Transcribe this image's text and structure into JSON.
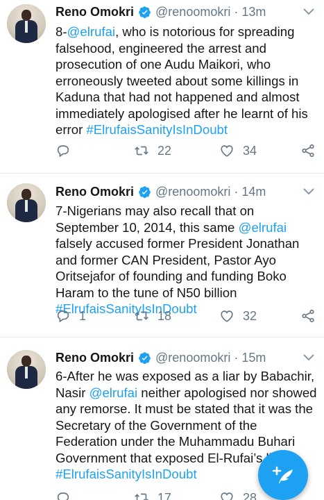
{
  "tweets": [
    {
      "name": "Reno Omokri",
      "handle": "@renoomokri",
      "dot": "·",
      "time": "13m",
      "text": [
        {
          "t": "8-",
          "link": false
        },
        {
          "t": "@elrufai",
          "link": true
        },
        {
          "t": ", who is notorious for spreading falsehood, engineered the arrest and prosecution of one Audu Maikori, who erroneously tweeted about some killings in Kaduna that had not happened and almost immediately apologised after he learnt of his error ",
          "link": false
        },
        {
          "t": "#ElrufaisSanityIsInDoubt",
          "link": true
        }
      ],
      "replies": "",
      "retweets": "22",
      "likes": "34"
    },
    {
      "name": "Reno Omokri",
      "handle": "@renoomokri",
      "dot": "·",
      "time": "14m",
      "text": [
        {
          "t": "7-Nigerians may also recall that on September 10, 2014, this same ",
          "link": false
        },
        {
          "t": "@elrufai",
          "link": true
        },
        {
          "t": " falsely accused former President Jonathan and former CAN President, Pastor Ayo Oritsejafor of founding and funding Boko Haram to the tune of N50 billion ",
          "link": false
        },
        {
          "t": "#ElrufaisSanityIsInDoubt",
          "link": true
        }
      ],
      "replies": "1",
      "retweets": "18",
      "likes": "32"
    },
    {
      "name": "Reno Omokri",
      "handle": "@renoomokri",
      "dot": "·",
      "time": "15m",
      "text": [
        {
          "t": "6-After he was exposed as a liar by Babachir, Nasir ",
          "link": false
        },
        {
          "t": "@elrufai",
          "link": true
        },
        {
          "t": " neither apologised nor showed any remorse. It must be stated that it was the Secretary of the Government of the Federation under the Muhammadu Buhari Government that exposed El-Rufai’s lies ",
          "link": false
        },
        {
          "t": "#ElrufaisSanityIsInDoubt",
          "link": true
        }
      ],
      "replies": "",
      "retweets": "17",
      "likes": "28"
    }
  ],
  "icons": {
    "verified": "verified-badge-icon",
    "caret": "chevron-down-icon",
    "reply": "reply-icon",
    "retweet": "retweet-icon",
    "like": "heart-icon",
    "share": "share-icon",
    "compose": "compose-tweet-icon"
  },
  "colors": {
    "accent": "#1da1f2",
    "secondary_text": "#657786",
    "divider": "#e6ecf0"
  }
}
